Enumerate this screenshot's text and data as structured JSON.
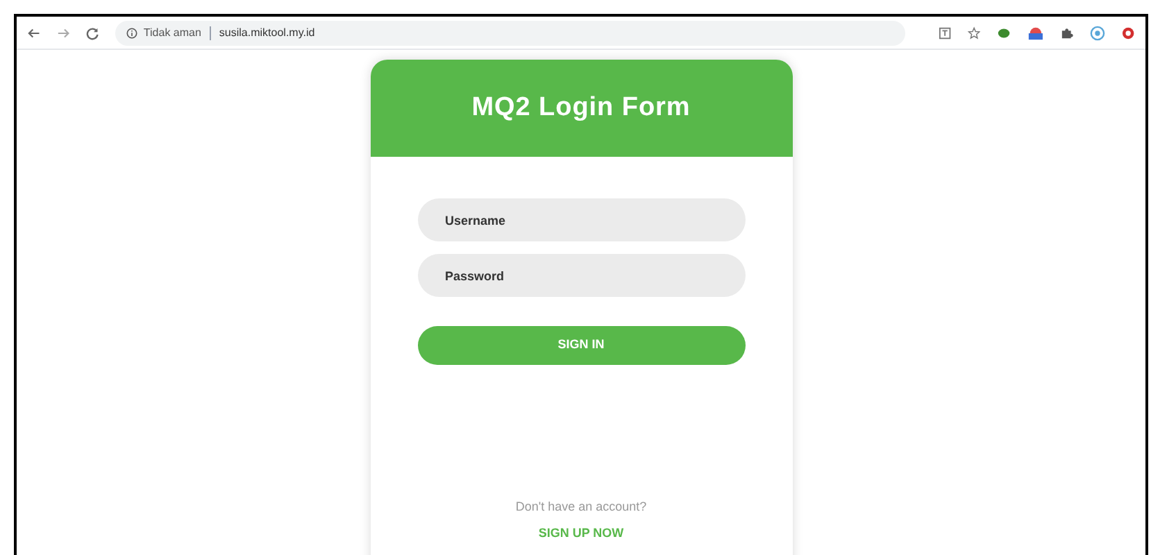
{
  "browser": {
    "security_label": "Tidak aman",
    "url": "susila.miktool.my.id"
  },
  "form": {
    "title": "MQ2 Login Form",
    "fields": [
      {
        "placeholder": "Username"
      },
      {
        "placeholder": "Password"
      }
    ],
    "submit_button": "SIGN IN",
    "signup_prompt": "Don't have an account?",
    "signup_link": "SIGN UP NOW"
  }
}
